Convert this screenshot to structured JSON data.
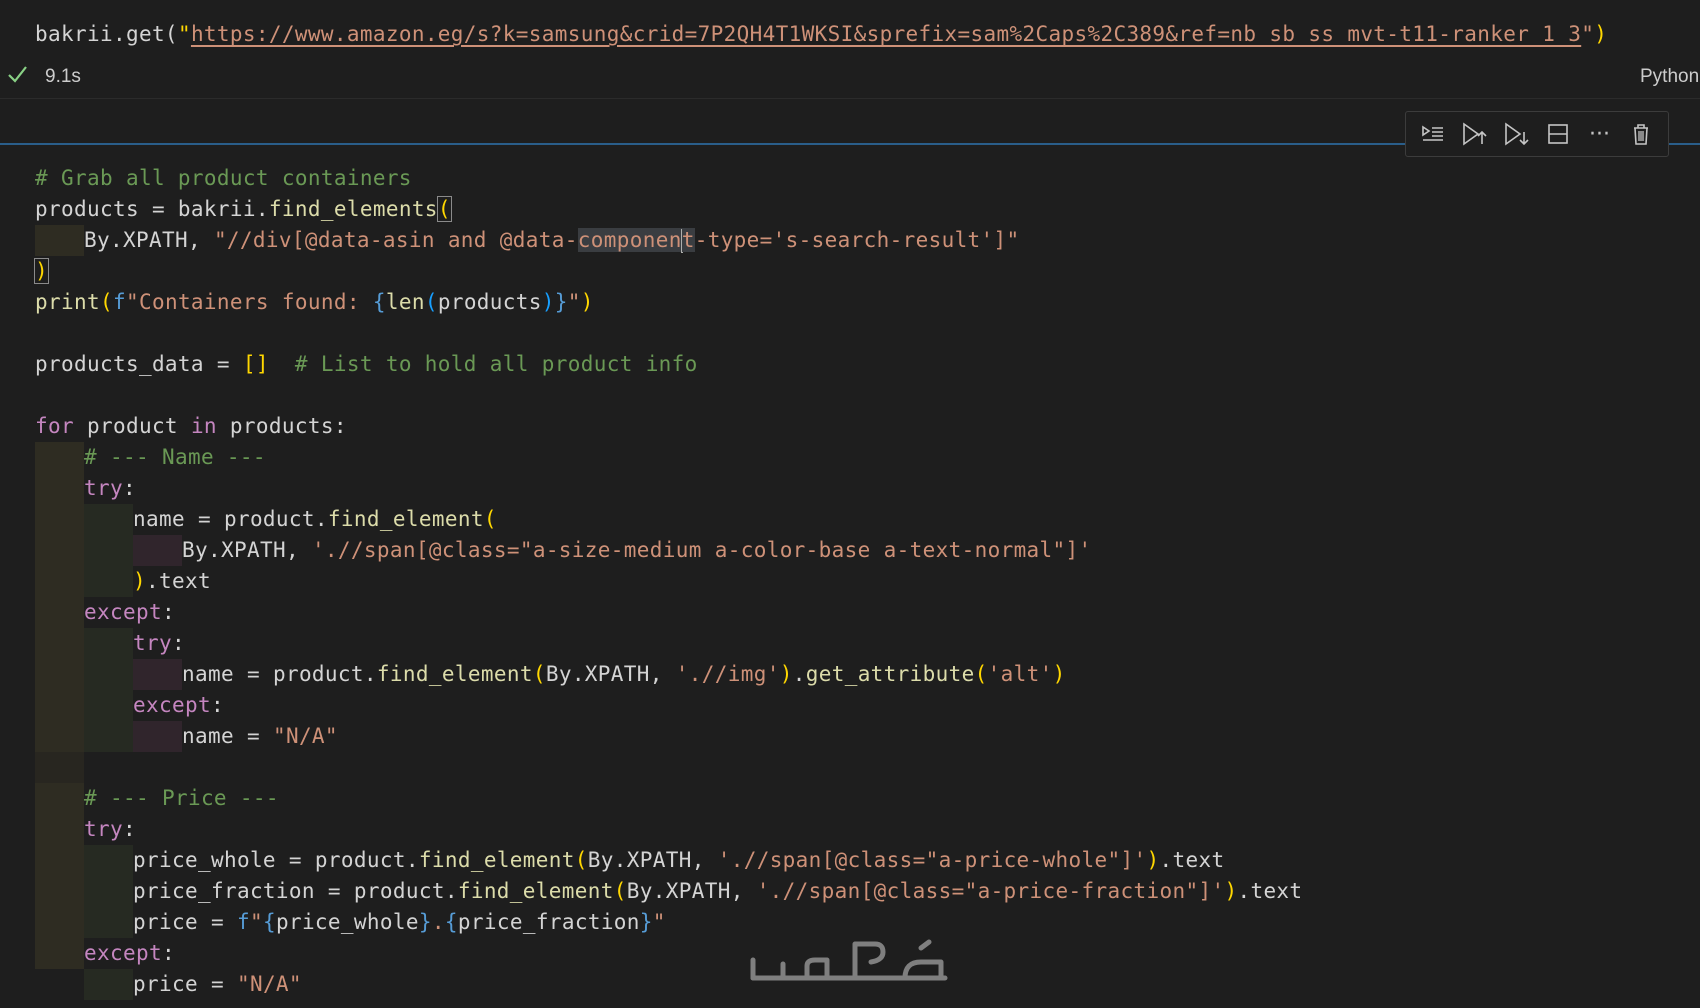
{
  "prev_cell": {
    "call_prefix": "bakrii.get(",
    "url": "https://www.amazon.eg/s?k=samsung&crid=7P2QH4T1WKSI&sprefix=sam%2Caps%2C389&ref=nb_sb_ss_mvt-t11-ranker_1_3",
    "exec_time": "9.1s",
    "language": "Python"
  },
  "toolbar": {
    "icons": [
      "run-by-line-icon",
      "execute-above-icon",
      "execute-below-icon",
      "split-cell-icon",
      "more-icon",
      "delete-icon"
    ],
    "more_glyph": "···"
  },
  "code": {
    "l1": "# Grab all product containers",
    "l2a": "products",
    "l2b": " = bakrii.",
    "l2c": "find_elements",
    "l3a": "By.XPATH, ",
    "l3b": "\"//div[@data-asin and @data-",
    "l3c": "componen",
    "l3d": "t",
    "l3e": "-type='s-search-result']\"",
    "l5a": "print",
    "l5b": "f",
    "l5c": "\"Containers found: ",
    "l5d": "len",
    "l5e": "products",
    "l6a": "products_data = ",
    "l6b": "  # List to hold all product info",
    "l7a": "for",
    "l7b": " product ",
    "l7c": "in",
    "l7d": " products:",
    "c_name": "# --- Name ---",
    "kw_try": "try",
    "name_a": "name = product.",
    "name_b": "find_element",
    "name_xp": "By.XPATH, ",
    "name_str": "'.//span[@class=\"a-size-medium a-color-base a-text-normal\"]'",
    "name_text": ".text",
    "kw_except": "except",
    "alt_a": "name = product.",
    "alt_b": "find_element",
    "alt_c": "By.XPATH, ",
    "alt_d": "'.//img'",
    "alt_e": ".",
    "alt_f": "get_attribute",
    "alt_g": "'alt'",
    "na_a": "name = ",
    "na_b": "\"N/A\"",
    "c_price": "# --- Price ---",
    "pw_a": "price_whole = product.",
    "pw_b": "find_element",
    "pw_c": "By.XPATH, ",
    "pw_d": "'.//span[@class=\"a-price-whole\"]'",
    "pw_e": ".text",
    "pf_a": "price_fraction = product.",
    "pf_b": "find_element",
    "pf_c": "By.XPATH, ",
    "pf_d": "'.//span[@class=\"a-price-fraction\"]'",
    "pf_e": ".text",
    "pr_a": "price = ",
    "pr_b": "f",
    "pr_c": "\"",
    "pr_d": "price_whole",
    "pr_e": ".",
    "pr_f": "price_fraction",
    "pr_g": "\"",
    "pna_a": "price = ",
    "pna_b": "\"N/A\""
  },
  "watermark_text": "خمسات"
}
